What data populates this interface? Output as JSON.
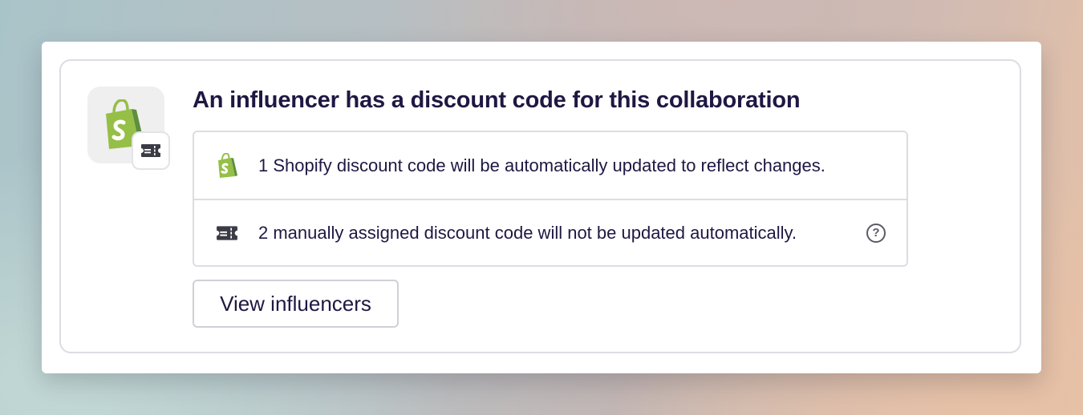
{
  "card": {
    "title": "An influencer has a discount code for this collaboration",
    "app_icon": "shopify-bag-icon",
    "badge_icon": "discount-ticket-icon",
    "info_rows": [
      {
        "icon": "shopify-bag-icon",
        "text": "1 Shopify discount code will be automatically updated to reflect changes."
      },
      {
        "icon": "discount-ticket-icon",
        "text": "2 manually assigned discount code will not be updated automatically.",
        "help_icon": "help-circle-icon",
        "help_glyph": "?"
      }
    ],
    "button_label": "View influencers"
  },
  "colors": {
    "text": "#1e1843",
    "shopify_green": "#95bf47",
    "shopify_dark_green": "#5e8e3e",
    "border": "#dcdde3",
    "ticket": "#3b3b46"
  }
}
